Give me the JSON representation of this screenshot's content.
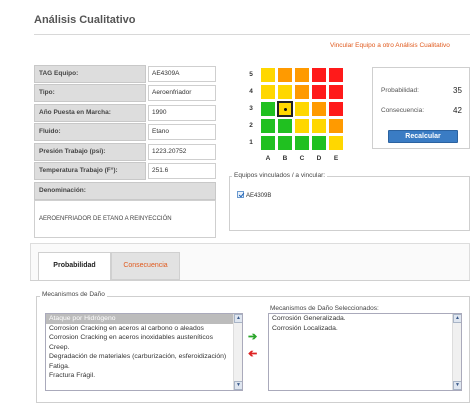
{
  "page": {
    "title": "Análisis Cualitativo",
    "vincular_link": "Vincular Equipo a otro Análisis Cualitativo"
  },
  "equipment_info": {
    "rows": [
      {
        "label": "TAG Equipo:",
        "value": "AE4309A"
      },
      {
        "label": "Tipo:",
        "value": "Aeroenfriador"
      },
      {
        "label": "Año Puesta en Marcha:",
        "value": "1990"
      },
      {
        "label": "Fluido:",
        "value": "Etano"
      },
      {
        "label": "Presión Trabajo (psi):",
        "value": "1223.20752"
      },
      {
        "label": "Temperatura Trabajo (F°):",
        "value": "251.6"
      }
    ],
    "denominacion_label": "Denominación:",
    "denominacion_value": "AEROENFRIADOR DE ETANO A REINYECCIÓN"
  },
  "risk_matrix": {
    "y_labels": [
      "5",
      "4",
      "3",
      "2",
      "1"
    ],
    "x_labels": [
      "A",
      "B",
      "C",
      "D",
      "E"
    ],
    "rows": [
      [
        "yellow",
        "orange",
        "orange",
        "red",
        "red"
      ],
      [
        "yellow",
        "yellow",
        "orange",
        "red",
        "red"
      ],
      [
        "green",
        "yellow",
        "yellow",
        "orange",
        "red"
      ],
      [
        "green",
        "green",
        "yellow",
        "yellow",
        "orange"
      ],
      [
        "green",
        "green",
        "green",
        "green",
        "yellow"
      ]
    ],
    "selected": {
      "row_label": "3",
      "col_label": "B"
    }
  },
  "scores": {
    "probabilidad_label": "Probabilidad:",
    "probabilidad_value": "35",
    "consecuencia_label": "Consecuencia:",
    "consecuencia_value": "42",
    "recalcular_label": "Recalcular"
  },
  "linked": {
    "legend": "Equipos vinculados / a vincular:",
    "items": [
      {
        "label": "AE4309B",
        "checked": true
      }
    ]
  },
  "tabs": [
    {
      "label": "Probabilidad",
      "active": true
    },
    {
      "label": "Consecuencia",
      "active": false
    }
  ],
  "mechanisms": {
    "legend": "Mecanismos de Daño",
    "available": [
      "Ataque por Hidrógeno",
      "Corrosion Cracking en aceros al carbono o aleados",
      "Corrosion Cracking en aceros inoxidables austeníticos",
      "Creep.",
      "Degradación de materiales (carburización, esferoidización)",
      "Fatiga.",
      "Fractura Frágil."
    ],
    "selected_index": 0,
    "selected_label": "Mecanismos de Daño Seleccionados:",
    "selected": [
      "Corrosión Generalizada.",
      "Corrosión Localizada."
    ]
  },
  "colors": {
    "accent_orange": "#e05a1e",
    "button_blue": "#3a7cc4",
    "green": "#20c020",
    "yellow": "#ffd700",
    "orange": "#ff9a00",
    "red": "#ff1a1a"
  }
}
